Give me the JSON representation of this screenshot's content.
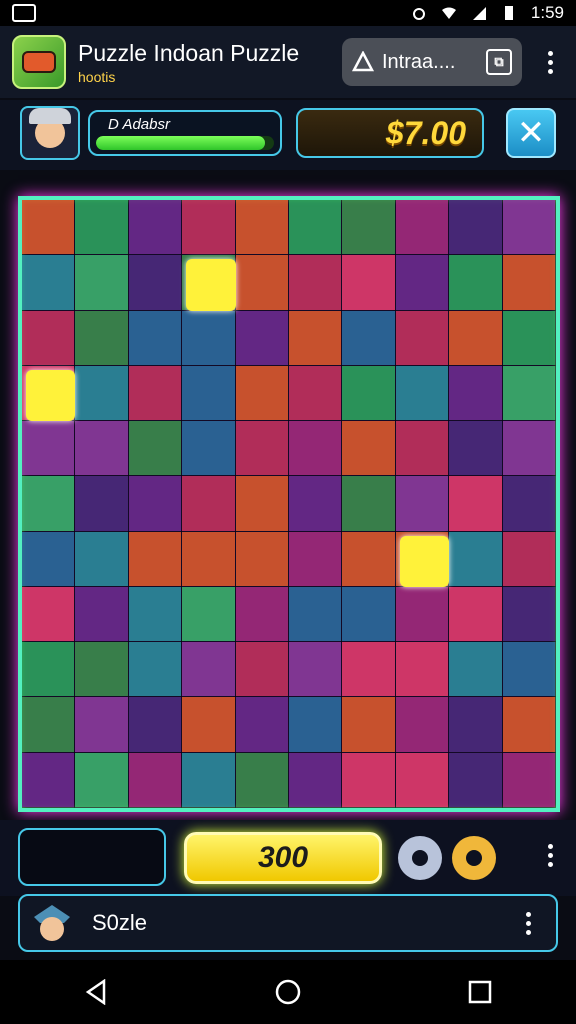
{
  "status": {
    "time": "1:59"
  },
  "app": {
    "title": "Puzzle Indoan Puzzle",
    "subtitle": "hootis"
  },
  "search": {
    "text": "Intraa...."
  },
  "hud": {
    "player_label": "D Adabsr",
    "progress": 0.95,
    "money": "$7.00"
  },
  "controls": {
    "score": "300"
  },
  "player": {
    "name": "S0zle"
  },
  "colors": {
    "accent": "#46c8e8",
    "board_border": "#53f0c0",
    "money": "#ffd83b",
    "progress": "#2fc52a"
  },
  "board": {
    "cols": 10,
    "rows": 11
  }
}
